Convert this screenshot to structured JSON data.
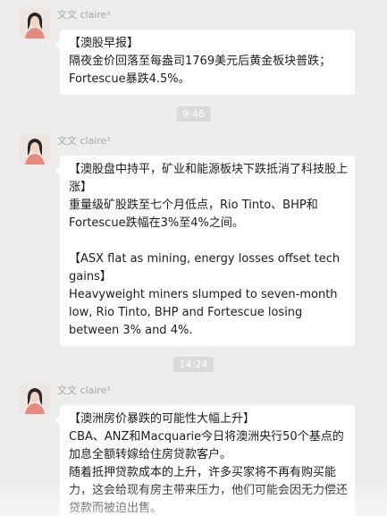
{
  "messages": [
    {
      "sender": "文文 claire¹",
      "paragraphs": [
        "【澳股早报】\n隔夜金价回落至每盎司1769美元后黄金板块普跌；Fortescue暴跌4.5%。"
      ]
    },
    {
      "sender": "文文 claire¹",
      "paragraphs": [
        "【澳股盘中持平，矿业和能源板块下跌抵消了科技股上涨】\n重量级矿股跌至七个月低点，Rio Tinto、BHP和Fortescue跌幅在3%至4%之间。",
        "【ASX flat as mining, energy losses offset tech gains】\nHeavyweight miners slumped to seven-month low, Rio Tinto, BHP and Fortescue losing between 3% and 4%."
      ]
    },
    {
      "sender": "文文 claire¹",
      "paragraphs": [
        "【澳洲房价暴跌的可能性大幅上升】\nCBA、ANZ和Macquarie今日将澳洲央行50个基点的加息全额转嫁给住房贷款客户。\n随着抵押贷款成本的上升，许多买家将不再有购买能力，这会给现有房主带来压力，他们可能会因无力偿还贷款而被迫出售。"
      ]
    }
  ],
  "timestamps": [
    "9:46",
    "14:24"
  ]
}
